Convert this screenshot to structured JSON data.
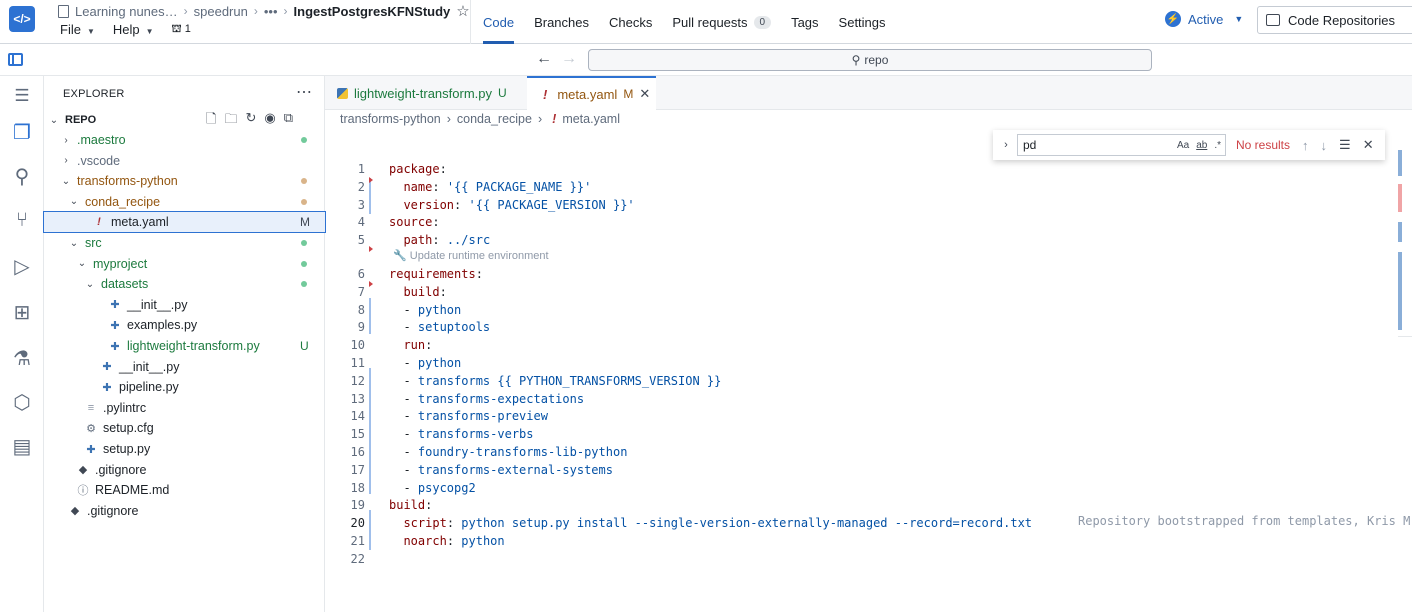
{
  "topbar": {
    "breadcrumb": [
      "Learning nunes…",
      "speedrun",
      "•••",
      "IngestPostgresKFNStudy"
    ],
    "star": "☆",
    "menus": [
      "File",
      "Help"
    ],
    "branch_count": "1",
    "tabs": [
      {
        "label": "Code",
        "active": true
      },
      {
        "label": "Branches"
      },
      {
        "label": "Checks"
      },
      {
        "label": "Pull requests",
        "count": "0"
      },
      {
        "label": "Tags"
      },
      {
        "label": "Settings"
      }
    ],
    "status": "Active",
    "repos_button": "Code Repositories"
  },
  "searchbar": {
    "value": "repo"
  },
  "explorer": {
    "title": "EXPLORER",
    "root": "REPO",
    "items": [
      {
        "label": ".maestro",
        "type": "folder",
        "color": "#1c7a3e",
        "status": "dot-green"
      },
      {
        "label": ".vscode",
        "type": "folder",
        "color": "#5f6b7c"
      },
      {
        "label": "transforms-python",
        "type": "folder",
        "color": "#935610",
        "status": "dot-orange"
      },
      {
        "label": "conda_recipe",
        "type": "folder",
        "color": "#935610",
        "status": "dot-orange"
      },
      {
        "label": "meta.yaml",
        "type": "yaml",
        "color": "#1c2127",
        "status": "M"
      },
      {
        "label": "src",
        "type": "folder",
        "color": "#1c7a3e",
        "status": "dot-green"
      },
      {
        "label": "myproject",
        "type": "folder",
        "color": "#1c7a3e",
        "status": "dot-green"
      },
      {
        "label": "datasets",
        "type": "folder",
        "color": "#1c7a3e",
        "status": "dot-green"
      },
      {
        "label": "__init__.py",
        "type": "py",
        "color": "#1c2127"
      },
      {
        "label": "examples.py",
        "type": "py",
        "color": "#1c2127"
      },
      {
        "label": "lightweight-transform.py",
        "type": "py",
        "color": "#1c7a3e",
        "status": "U"
      },
      {
        "label": "__init__.py",
        "type": "py",
        "color": "#1c2127"
      },
      {
        "label": "pipeline.py",
        "type": "py",
        "color": "#1c2127"
      },
      {
        "label": ".pylintrc",
        "type": "text",
        "color": "#1c2127"
      },
      {
        "label": "setup.cfg",
        "type": "gear",
        "color": "#1c2127"
      },
      {
        "label": "setup.py",
        "type": "py",
        "color": "#1c2127"
      },
      {
        "label": ".gitignore",
        "type": "git",
        "color": "#1c2127"
      },
      {
        "label": "README.md",
        "type": "info",
        "color": "#1c2127"
      },
      {
        "label": ".gitignore",
        "type": "git",
        "color": "#1c2127"
      }
    ]
  },
  "editor": {
    "tabs": [
      {
        "label": "lightweight-transform.py",
        "badge": "U"
      },
      {
        "label": "meta.yaml",
        "badge": "M",
        "active": true
      }
    ],
    "breadcrumb": [
      "transforms-python",
      "conda_recipe",
      "meta.yaml"
    ],
    "codelens": "Update runtime environment",
    "blame": "Repository bootstrapped from templates, Kris M",
    "lines": [
      {
        "n": "1",
        "t": "package:"
      },
      {
        "n": "2",
        "t": "  name: '{{ PACKAGE_NAME }}'"
      },
      {
        "n": "3",
        "t": "  version: '{{ PACKAGE_VERSION }}'"
      },
      {
        "n": "4",
        "t": "source:"
      },
      {
        "n": "5",
        "t": "  path: ../src"
      },
      {
        "n": "6",
        "t": "requirements:"
      },
      {
        "n": "7",
        "t": "  build:"
      },
      {
        "n": "8",
        "t": "  - python"
      },
      {
        "n": "9",
        "t": "  - setuptools"
      },
      {
        "n": "10",
        "t": "  run:"
      },
      {
        "n": "11",
        "t": "  - python"
      },
      {
        "n": "12",
        "t": "  - transforms {{ PYTHON_TRANSFORMS_VERSION }}"
      },
      {
        "n": "13",
        "t": "  - transforms-expectations"
      },
      {
        "n": "14",
        "t": "  - transforms-preview"
      },
      {
        "n": "15",
        "t": "  - transforms-verbs"
      },
      {
        "n": "16",
        "t": "  - foundry-transforms-lib-python"
      },
      {
        "n": "17",
        "t": "  - transforms-external-systems"
      },
      {
        "n": "18",
        "t": "  - psycopg2"
      },
      {
        "n": "19",
        "t": "build:"
      },
      {
        "n": "20",
        "t": "  script: python setup.py install --single-version-externally-managed --record=record.txt"
      },
      {
        "n": "21",
        "t": "  noarch: python"
      },
      {
        "n": "22",
        "t": ""
      }
    ]
  },
  "find": {
    "query": "pd",
    "options": [
      "Aa",
      "ab",
      ".*"
    ],
    "result": "No results"
  }
}
